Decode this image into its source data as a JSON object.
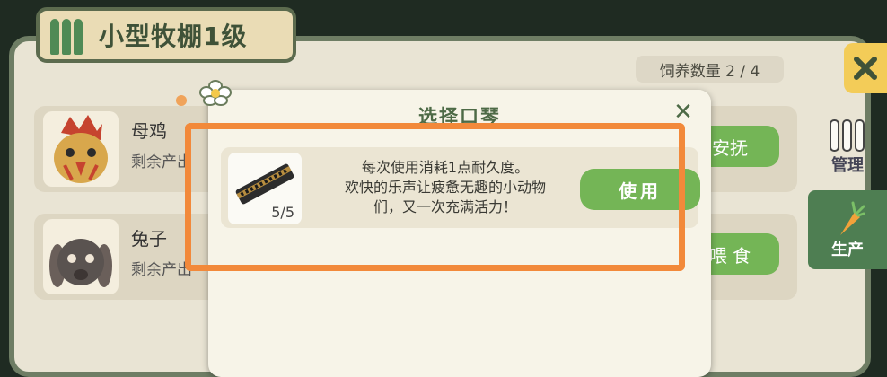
{
  "panel": {
    "title": "小型牧棚1级",
    "capacity_text": "饲养数量 2 / 4"
  },
  "animals": [
    {
      "name": "母鸡",
      "sub": "剩余产出",
      "action": "安抚",
      "portrait_icon": "rooster-icon"
    },
    {
      "name": "兔子",
      "sub": "剩余产出",
      "action": "喂 食",
      "portrait_icon": "rabbit-icon"
    }
  ],
  "side_tabs": [
    {
      "label": "管理",
      "icon": "fence-icon"
    },
    {
      "label": "生产",
      "icon": "carrot-icon"
    }
  ],
  "dialog": {
    "title": "选择口琴",
    "close_icon": "close-icon",
    "item": {
      "name_icon": "harmonica-icon",
      "count": "5/5",
      "desc_line1": "每次使用消耗1点耐久度。",
      "desc_line2": "欢快的乐声让疲惫无趣的小动物",
      "desc_line3": "们，又一次充满活力！",
      "use_label": "使用"
    }
  },
  "colors": {
    "highlight": "#f2893a",
    "button_green": "#74b556",
    "title_green": "#4d6a46"
  }
}
